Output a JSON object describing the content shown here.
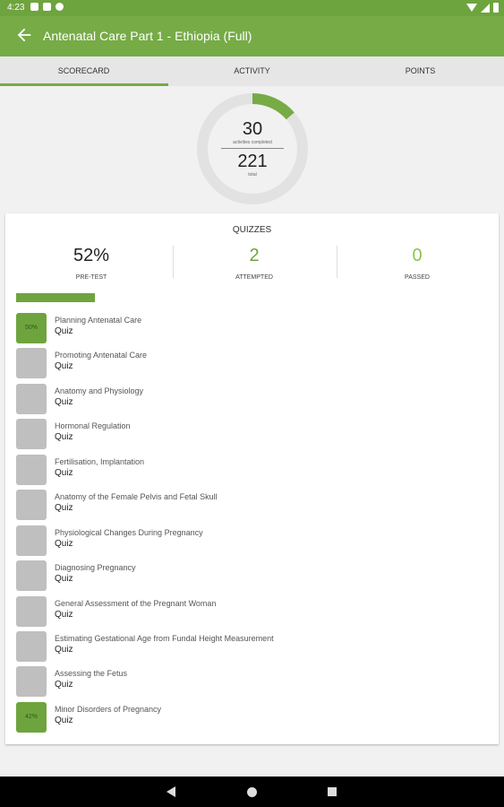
{
  "status_bar": {
    "time": "4:23"
  },
  "app_bar": {
    "title": "Antenatal Care Part 1 - Ethiopia (Full)"
  },
  "tabs": [
    {
      "label": "SCORECARD",
      "active": true
    },
    {
      "label": "ACTIVITY",
      "active": false
    },
    {
      "label": "POINTS",
      "active": false
    }
  ],
  "summary": {
    "completed": "30",
    "completed_label": "activities completed",
    "total": "221",
    "total_label": "total",
    "progress_fraction": 0.136
  },
  "quizzes": {
    "heading": "QUIZZES",
    "pretest_value": "52%",
    "pretest_label": "PRE-TEST",
    "attempted_value": "2",
    "attempted_label": "ATTEMPTED",
    "passed_value": "0",
    "passed_label": "PASSED",
    "progress_fraction": 0.16,
    "items": [
      {
        "name": "Planning Antenatal Care",
        "type": "Quiz",
        "score": "50%"
      },
      {
        "name": "Promoting Antenatal Care",
        "type": "Quiz",
        "score": ""
      },
      {
        "name": "Anatomy and Physiology",
        "type": "Quiz",
        "score": ""
      },
      {
        "name": "Hormonal Regulation",
        "type": "Quiz",
        "score": ""
      },
      {
        "name": "Fertilisation, Implantation",
        "type": "Quiz",
        "score": ""
      },
      {
        "name": "Anatomy of the Female Pelvis and Fetal Skull",
        "type": "Quiz",
        "score": ""
      },
      {
        "name": "Physiological Changes During Pregnancy",
        "type": "Quiz",
        "score": ""
      },
      {
        "name": "Diagnosing Pregnancy",
        "type": "Quiz",
        "score": ""
      },
      {
        "name": "General Assessment of the Pregnant Woman",
        "type": "Quiz",
        "score": ""
      },
      {
        "name": "Estimating Gestational Age from Fundal Height Measurement",
        "type": "Quiz",
        "score": ""
      },
      {
        "name": "Assessing the Fetus",
        "type": "Quiz",
        "score": ""
      },
      {
        "name": "Minor Disorders of Pregnancy",
        "type": "Quiz",
        "score": "42%"
      }
    ]
  },
  "colors": {
    "accent": "#76ab46",
    "muted_box": "#bfbfbf",
    "ring_bg": "#e2e2e2"
  }
}
